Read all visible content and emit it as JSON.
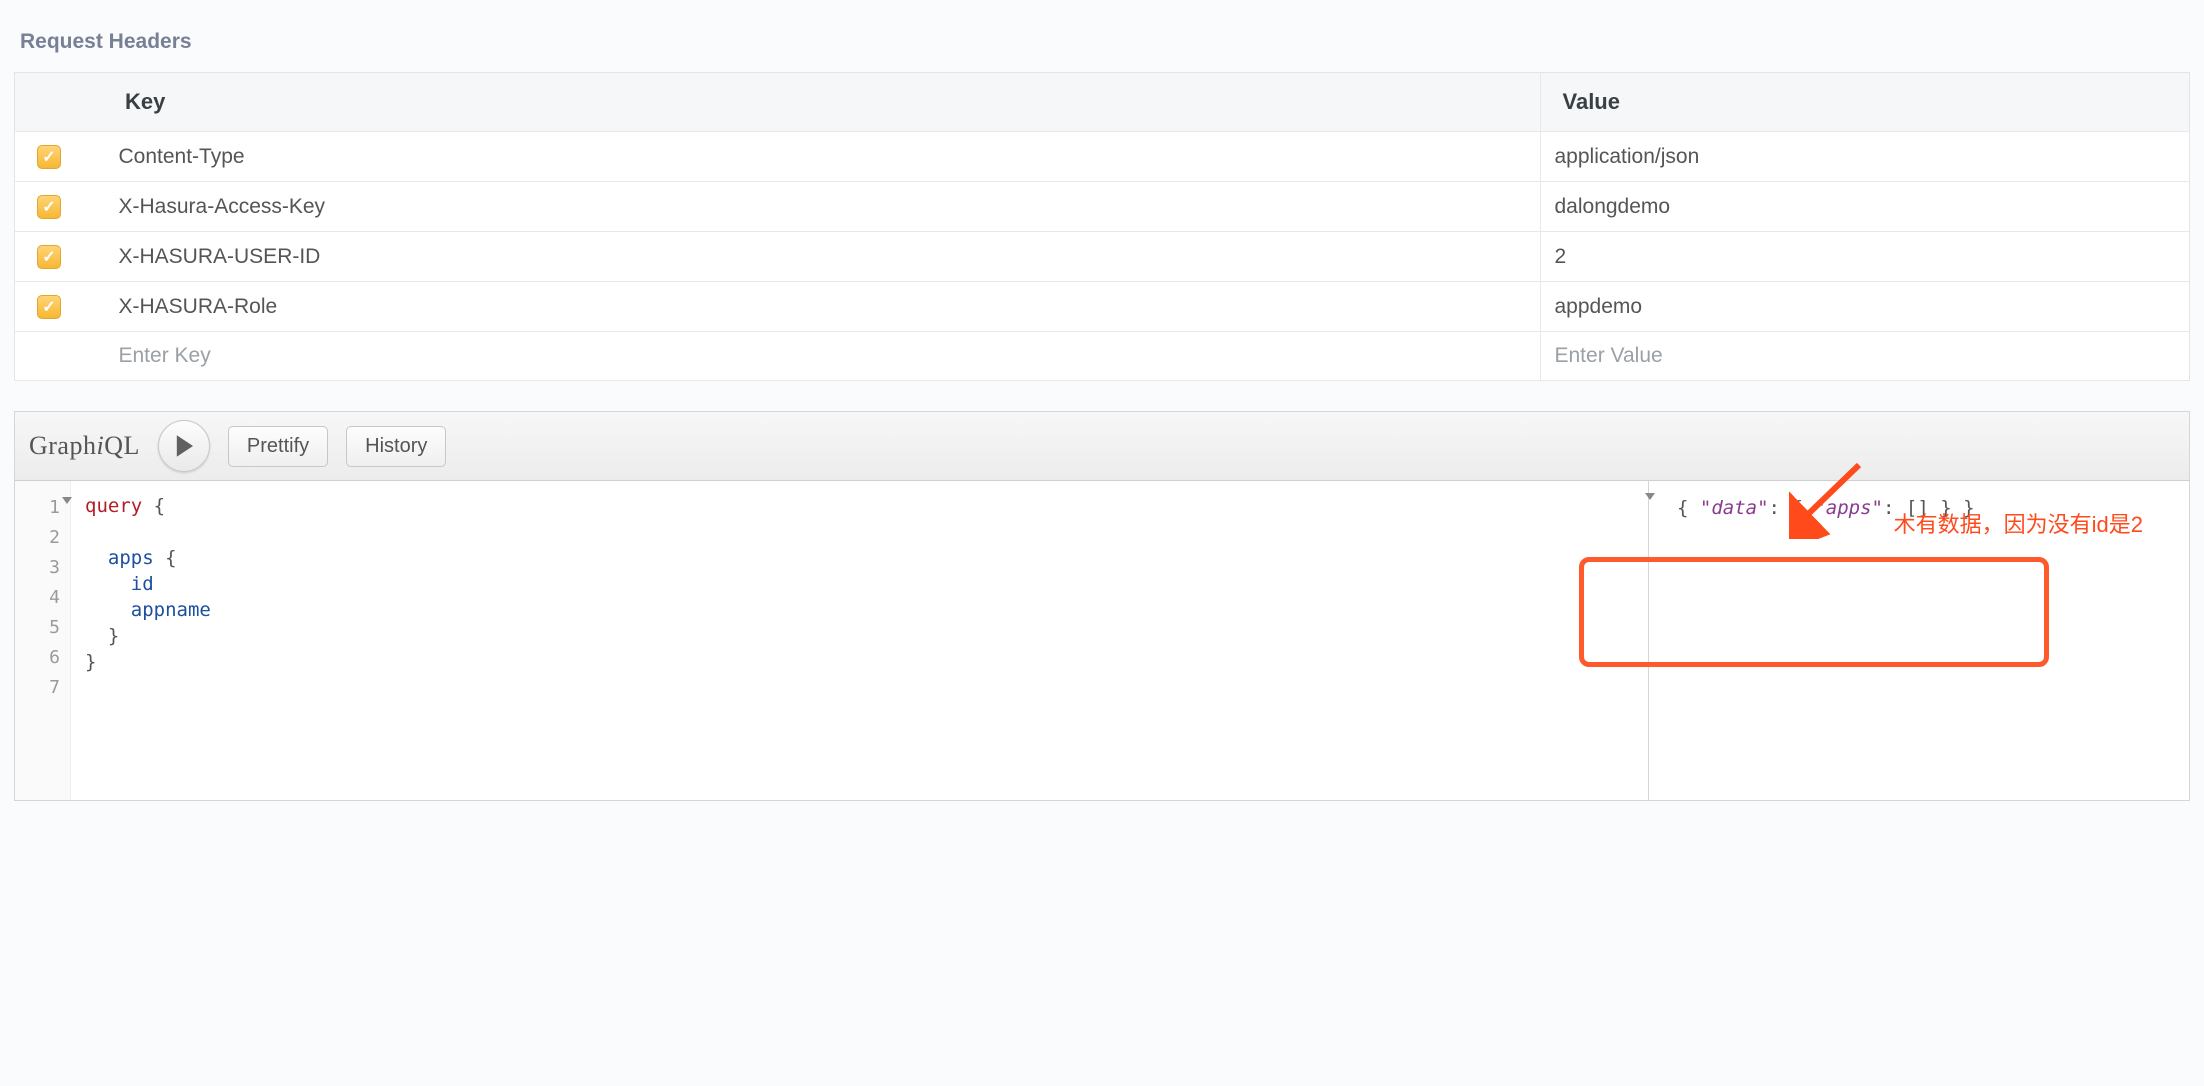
{
  "section_title": "Request Headers",
  "table": {
    "header_key": "Key",
    "header_value": "Value",
    "rows": [
      {
        "checked": true,
        "key": "Content-Type",
        "value": "application/json"
      },
      {
        "checked": true,
        "key": "X-Hasura-Access-Key",
        "value": "dalongdemo"
      },
      {
        "checked": true,
        "key": "X-HASURA-USER-ID",
        "value": "2"
      },
      {
        "checked": true,
        "key": "X-HASURA-Role",
        "value": "appdemo"
      }
    ],
    "placeholder_key": "Enter Key",
    "placeholder_value": "Enter Value"
  },
  "toolbar": {
    "logo_prefix": "Graph",
    "logo_i": "i",
    "logo_suffix": "QL",
    "prettify_label": "Prettify",
    "history_label": "History"
  },
  "query": {
    "gutter": [
      "1",
      "2",
      "3",
      "4",
      "5",
      "6",
      "7"
    ],
    "kw_query": "query",
    "brace_open": "{",
    "brace_close": "}",
    "field_apps": "apps",
    "field_id": "id",
    "field_appname": "appname"
  },
  "result": {
    "brace_open": "{",
    "brace_close": "}",
    "key_data": "\"data\"",
    "key_apps": "\"apps\"",
    "colon": ":",
    "empty_array": "[]"
  },
  "annotation_text": "木有数据，因为没有id是2"
}
